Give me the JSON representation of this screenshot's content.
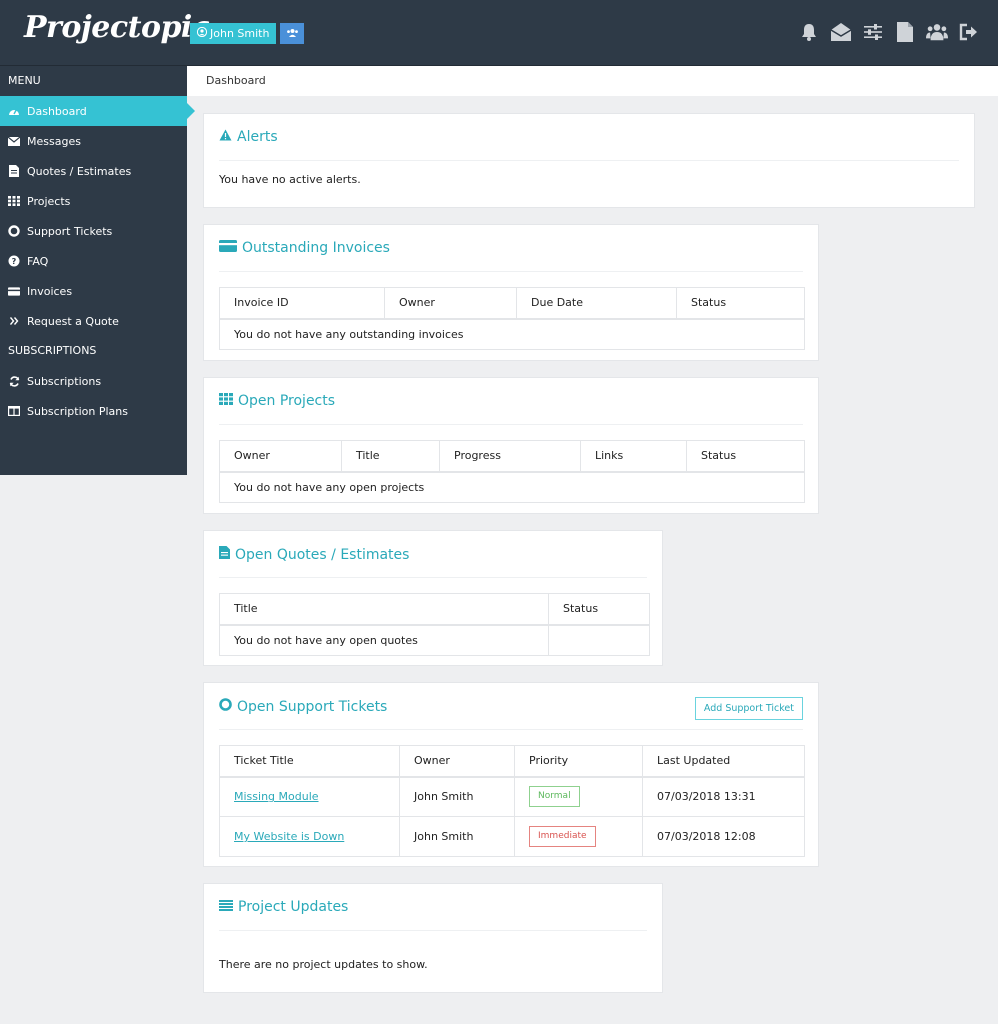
{
  "header": {
    "logo_text": "Projectopia",
    "user_name": "John Smith",
    "icons": [
      "bell-icon",
      "envelope-open-icon",
      "sliders-icon",
      "file-icon",
      "users-icon",
      "sign-out-icon"
    ]
  },
  "sidebar": {
    "menu_heading": "MENU",
    "items": [
      {
        "label": "Dashboard",
        "icon": "tachometer-icon"
      },
      {
        "label": "Messages",
        "icon": "envelope-icon"
      },
      {
        "label": "Quotes / Estimates",
        "icon": "file-text-icon"
      },
      {
        "label": "Projects",
        "icon": "grid-icon"
      },
      {
        "label": "Support Tickets",
        "icon": "life-ring-icon"
      },
      {
        "label": "FAQ",
        "icon": "question-circle-icon"
      },
      {
        "label": "Invoices",
        "icon": "credit-card-icon"
      },
      {
        "label": "Request a Quote",
        "icon": "double-chevron-icon"
      }
    ],
    "subscriptions_heading": "SUBSCRIPTIONS",
    "sub_items": [
      {
        "label": "Subscriptions",
        "icon": "refresh-icon"
      },
      {
        "label": "Subscription Plans",
        "icon": "columns-icon"
      }
    ]
  },
  "breadcrumb": "Dashboard",
  "alerts": {
    "title": "Alerts",
    "message": "You have no active alerts."
  },
  "invoices": {
    "title": "Outstanding Invoices",
    "columns": [
      "Invoice ID",
      "Owner",
      "Due Date",
      "Status"
    ],
    "empty": "You do not have any outstanding invoices"
  },
  "projects": {
    "title": "Open Projects",
    "columns": [
      "Owner",
      "Title",
      "Progress",
      "Links",
      "Status"
    ],
    "empty": "You do not have any open projects"
  },
  "quotes": {
    "title": "Open Quotes / Estimates",
    "columns": [
      "Title",
      "Status"
    ],
    "empty": "You do not have any open quotes"
  },
  "tickets": {
    "title": "Open Support Tickets",
    "add_button": "Add Support Ticket",
    "columns": [
      "Ticket Title",
      "Owner",
      "Priority",
      "Last Updated"
    ],
    "rows": [
      {
        "title": "Missing Module",
        "owner": "John Smith",
        "priority": "Normal",
        "updated": "07/03/2018 13:31"
      },
      {
        "title": "My Website is Down",
        "owner": "John Smith",
        "priority": "Immediate",
        "updated": "07/03/2018 12:08"
      }
    ]
  },
  "updates": {
    "title": "Project Updates",
    "message": "There are no project updates to show."
  },
  "colors": {
    "accent": "#35c2d3",
    "dark": "#2e3a47",
    "normal": "#5cb85c",
    "immediate": "#d9534f"
  }
}
